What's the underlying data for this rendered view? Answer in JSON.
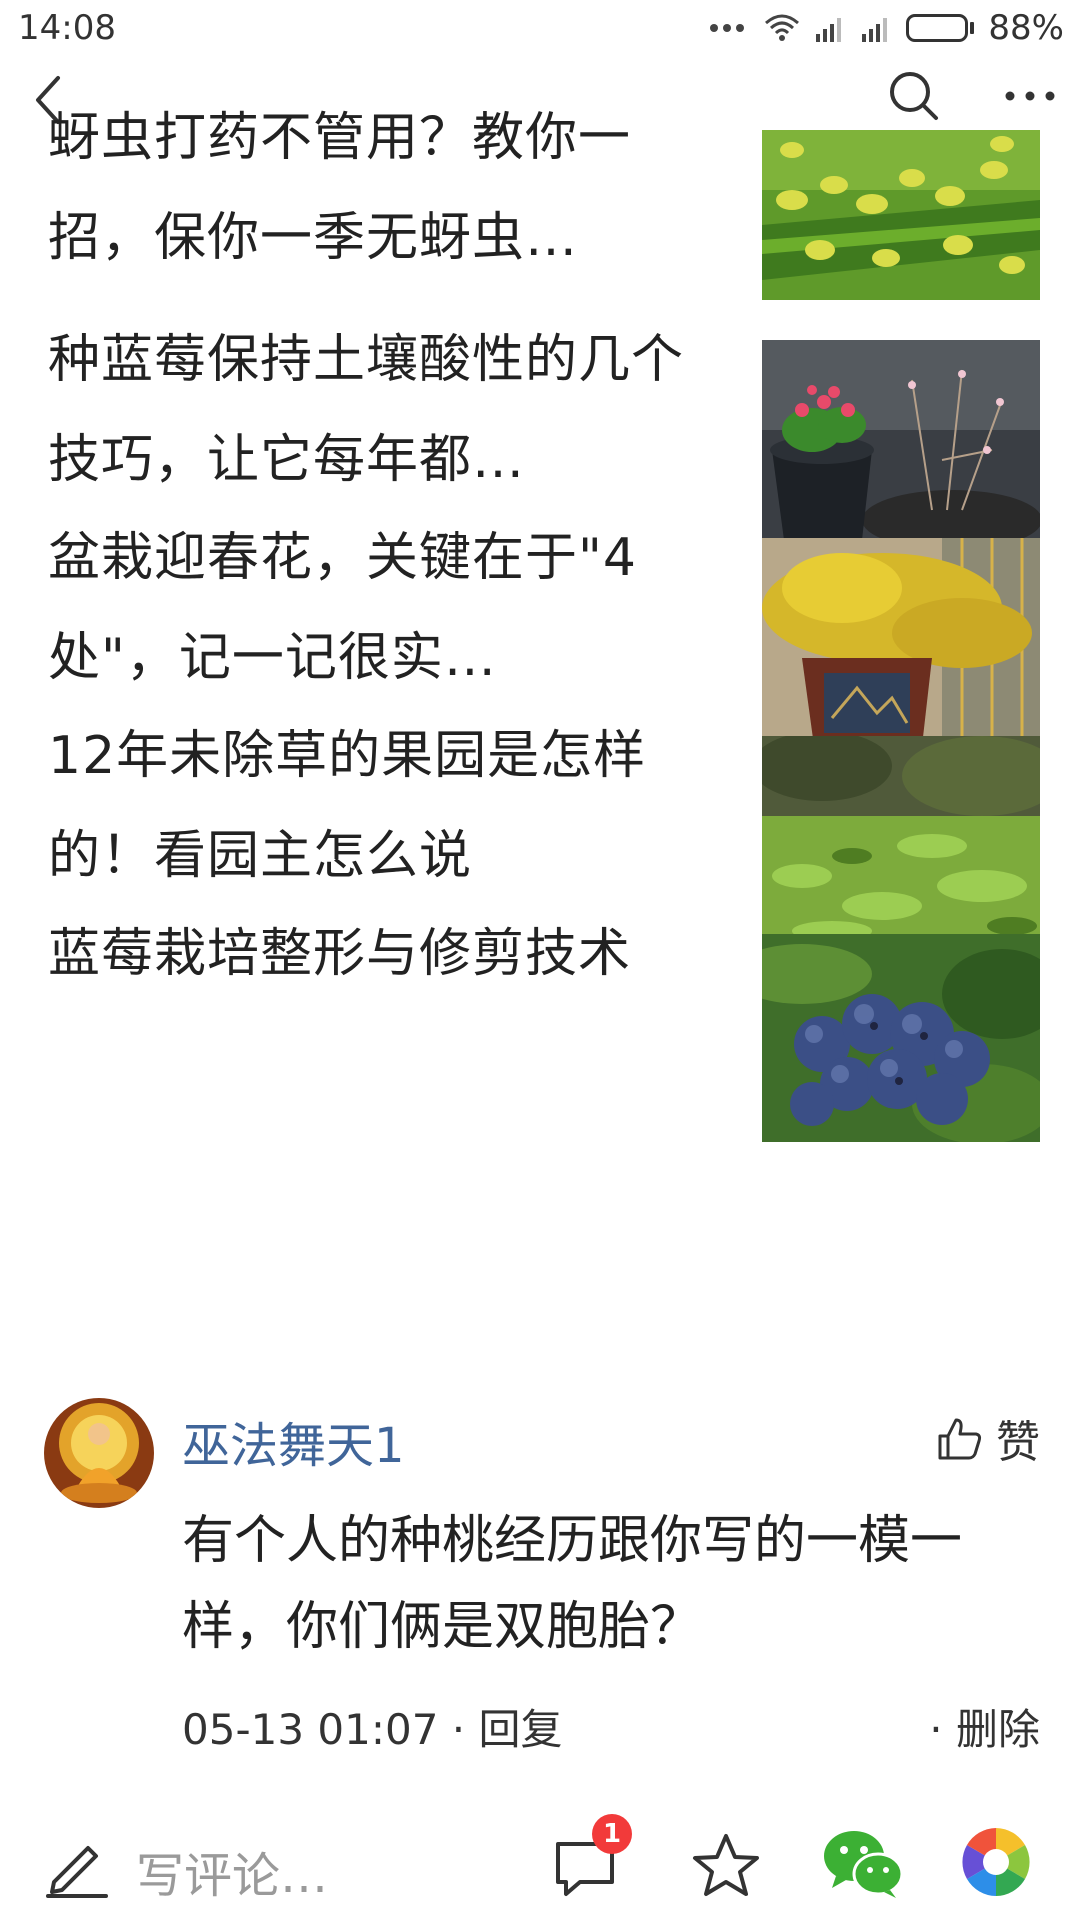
{
  "status_bar": {
    "time": "14:08",
    "battery": "88%",
    "battery_level": 0.88,
    "icons": [
      "more-dots-icon",
      "wifi-icon",
      "signal-icon",
      "signal-icon",
      "battery-icon"
    ]
  },
  "nav": {
    "back_icon": "chevron-left-icon",
    "search_icon": "search-icon",
    "more_icon": "more-horizontal-icon"
  },
  "articles": [
    {
      "title": "蚜虫打药不管用？教你一招，保你一季无蚜虫…",
      "thumb": "aphids-on-stem"
    },
    {
      "title": "种蓝莓保持土壤酸性的几个技巧，让它每年都…",
      "thumb": "potted-plants"
    },
    {
      "title": "盆栽迎春花，关键在于\"4处\"，记一记很实…",
      "thumb": "yellow-bonsai"
    },
    {
      "title": "12年未除草的果园是怎样的！看园主怎么说",
      "thumb": "green-orchard"
    },
    {
      "title": "蓝莓栽培整形与修剪技术",
      "thumb": "blueberries"
    }
  ],
  "comment": {
    "author": "巫法舞天1",
    "like_label": "赞",
    "text": "有个人的种桃经历跟你写的一模一样，你们俩是双胞胎？",
    "meta": "05-13 01:07 · 回复",
    "delete_label": "· 删除"
  },
  "bottom_bar": {
    "placeholder": "写评论…",
    "comment_badge": "1",
    "colors": {
      "badge": "#f23a3a",
      "wechat": "#3cb034"
    }
  }
}
